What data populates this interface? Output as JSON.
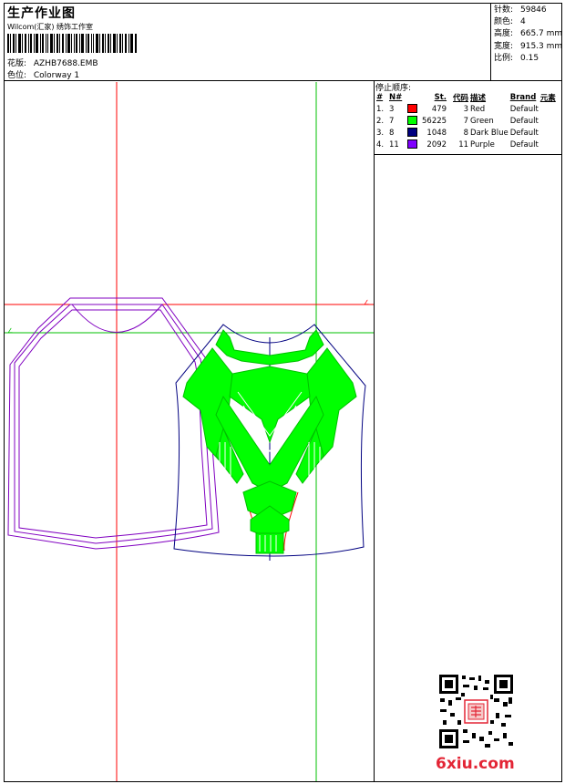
{
  "header": {
    "title": "生产作业图",
    "company": "Wilcom(汇家) 绣饰工作室",
    "design_label": "花版:",
    "design_value": "AZHB7688.EMB",
    "colorway_label": "色位:",
    "colorway_value": "Colorway 1"
  },
  "stats": [
    {
      "label": "针数:",
      "value": "59846"
    },
    {
      "label": "颜色:",
      "value": "4"
    },
    {
      "label": "高度:",
      "value": "665.7 mm"
    },
    {
      "label": "宽度:",
      "value": "915.3 mm"
    },
    {
      "label": "比例:",
      "value": "0.15"
    }
  ],
  "stop_sequence": {
    "title": "停止顺序:",
    "headers": [
      "#",
      "N#",
      "St.",
      "代码",
      "描述",
      "Brand",
      "元素"
    ],
    "rows": [
      {
        "idx": "1.",
        "n": "3",
        "color": "#ff0000",
        "st": "479",
        "code": "3",
        "desc": "Red",
        "brand": "Default"
      },
      {
        "idx": "2.",
        "n": "7",
        "color": "#00ff00",
        "st": "56225",
        "code": "7",
        "desc": "Green",
        "brand": "Default"
      },
      {
        "idx": "3.",
        "n": "8",
        "color": "#000080",
        "st": "1048",
        "code": "8",
        "desc": "Dark Blue",
        "brand": "Default"
      },
      {
        "idx": "4.",
        "n": "11",
        "color": "#8000ff",
        "st": "2092",
        "code": "11",
        "desc": "Purple",
        "brand": "Default"
      }
    ]
  },
  "watermark": "6xiu.com",
  "colors": {
    "red": "#ff0000",
    "green": "#00ff00",
    "blue": "#000080",
    "purple": "#8000c0"
  }
}
